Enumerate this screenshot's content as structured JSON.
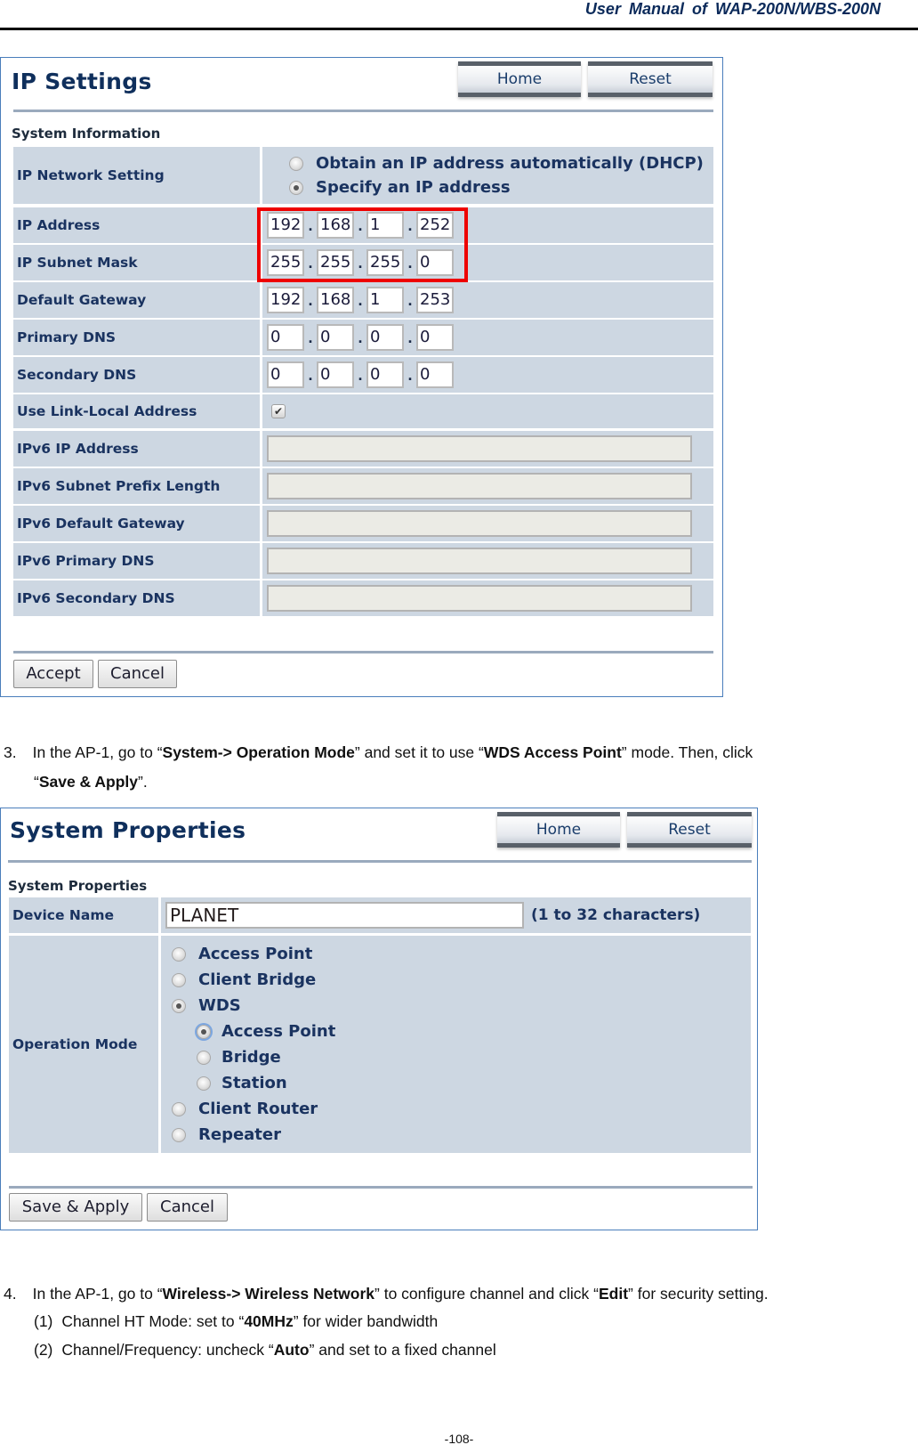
{
  "header": {
    "title": "User  Manual  of  WAP-200N/WBS-200N"
  },
  "ip_settings": {
    "title": "IP Settings",
    "home_label": "Home",
    "reset_label": "Reset",
    "section": "System Information",
    "network_setting": {
      "label": "IP Network Setting",
      "options": [
        {
          "label": "Obtain an IP address automatically (DHCP)",
          "checked": false
        },
        {
          "label": "Specify an IP address",
          "checked": true
        }
      ]
    },
    "ip_address": {
      "label": "IP Address",
      "octets": [
        "192",
        "168",
        "1",
        "252"
      ]
    },
    "subnet_mask": {
      "label": "IP Subnet Mask",
      "octets": [
        "255",
        "255",
        "255",
        "0"
      ]
    },
    "default_gateway": {
      "label": "Default Gateway",
      "octets": [
        "192",
        "168",
        "1",
        "253"
      ]
    },
    "primary_dns": {
      "label": "Primary DNS",
      "octets": [
        "0",
        "0",
        "0",
        "0"
      ]
    },
    "secondary_dns": {
      "label": "Secondary DNS",
      "octets": [
        "0",
        "0",
        "0",
        "0"
      ]
    },
    "link_local": {
      "label": "Use Link-Local Address",
      "checked": true
    },
    "ipv6_ip": {
      "label": "IPv6 IP Address",
      "value": ""
    },
    "ipv6_prefix": {
      "label": "IPv6 Subnet Prefix Length",
      "value": ""
    },
    "ipv6_gateway": {
      "label": "IPv6 Default Gateway",
      "value": ""
    },
    "ipv6_primary_dns": {
      "label": "IPv6 Primary DNS",
      "value": ""
    },
    "ipv6_secondary_dns": {
      "label": "IPv6 Secondary DNS",
      "value": ""
    },
    "accept_label": "Accept",
    "cancel_label": "Cancel",
    "highlight_color": "#ee0000"
  },
  "step3": {
    "number": "3.",
    "text_1": "In the AP-1, go to “",
    "bold_1": "System-> Operation Mode",
    "text_2": "” and set it to use “",
    "bold_2": "WDS Access Point",
    "text_3": "” mode. Then, click",
    "text_4": "“",
    "bold_3": "Save & Apply",
    "text_5": "”."
  },
  "system_properties": {
    "title": "System Properties",
    "home_label": "Home",
    "reset_label": "Reset",
    "section": "System Properties",
    "device_name": {
      "label": "Device Name",
      "value": "PLANET",
      "note": "(1 to 32 characters)"
    },
    "operation_mode": {
      "label": "Operation Mode",
      "options": [
        {
          "label": "Access Point",
          "checked": false
        },
        {
          "label": "Client Bridge",
          "checked": false
        },
        {
          "label": "WDS",
          "checked": true
        },
        {
          "label": "Access Point",
          "checked": true,
          "sub": true
        },
        {
          "label": "Bridge",
          "checked": false,
          "sub": true
        },
        {
          "label": "Station",
          "checked": false,
          "sub": true
        },
        {
          "label": "Client Router",
          "checked": false
        },
        {
          "label": "Repeater",
          "checked": false
        }
      ]
    },
    "save_label": "Save & Apply",
    "cancel_label": "Cancel"
  },
  "step4": {
    "number": "4.",
    "text_1": "In the AP-1, go to “",
    "bold_1": "Wireless-> Wireless Network",
    "text_2": "” to configure channel and click “",
    "bold_2": "Edit",
    "text_3": "” for security setting.",
    "sub_items": [
      {
        "number": "(1)",
        "text_1": "Channel HT Mode: set to “",
        "bold": "40MHz",
        "text_2": "” for wider bandwidth"
      },
      {
        "number": "(2)",
        "text_1": "Channel/Frequency: uncheck “",
        "bold": "Auto",
        "text_2": "” and set to a fixed channel"
      }
    ]
  },
  "footer": {
    "page_number": "-108-"
  }
}
